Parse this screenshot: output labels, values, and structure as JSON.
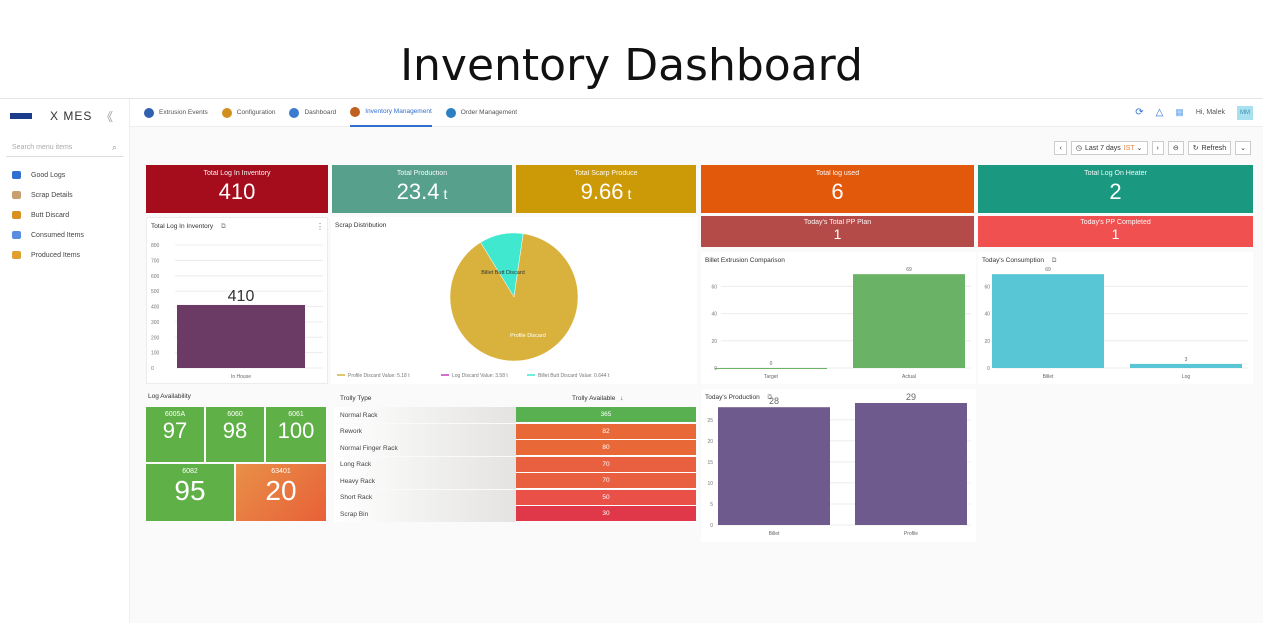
{
  "page_title": "Inventory Dashboard",
  "sidebar": {
    "brand": "X MES",
    "collapse": "《",
    "search_placeholder": "Search menu items",
    "items": [
      {
        "label": "Good Logs",
        "color": "#2f6fd0"
      },
      {
        "label": "Scrap Details",
        "color": "#c8a070"
      },
      {
        "label": "Butt Discard",
        "color": "#d89020"
      },
      {
        "label": "Consumed Items",
        "color": "#5a8fe0"
      },
      {
        "label": "Produced Items",
        "color": "#e0a030"
      }
    ]
  },
  "topnav": {
    "tabs": [
      {
        "label": "Extrusion Events",
        "color": "#3060b0"
      },
      {
        "label": "Configuration",
        "color": "#d09020"
      },
      {
        "label": "Dashboard",
        "color": "#3a7ad0"
      },
      {
        "label": "Inventory Management",
        "color": "#c06020"
      },
      {
        "label": "Order Management",
        "color": "#2a80c0"
      }
    ],
    "user_greeting": "Hi, Malek",
    "avatar_initials": "MM"
  },
  "timebar": {
    "prev": "‹",
    "range": "Last 7 days",
    "tz": "IST",
    "next": "›",
    "refresh": "Refresh"
  },
  "kpis": [
    {
      "label": "Total Log In Inventory",
      "value": "410",
      "unit": "",
      "color": "#a50d1c"
    },
    {
      "label": "Total Production",
      "value": "23.4",
      "unit": "t",
      "color": "#56a08c"
    },
    {
      "label": "Total Scarp Produce",
      "value": "9.66",
      "unit": "t",
      "color": "#cc9a06"
    },
    {
      "label": "Total log used",
      "value": "6",
      "unit": "",
      "color": "#e3590b"
    },
    {
      "label": "Total Log On Heater",
      "value": "2",
      "unit": "",
      "color": "#1a9880"
    }
  ],
  "pp_cards": [
    {
      "label": "Today's Total PP Plan",
      "value": "1",
      "color": "#b44b48"
    },
    {
      "label": "Today's PP Completed",
      "value": "1",
      "color": "#f05050"
    }
  ],
  "inventory_chart": {
    "title": "Total Log In Inventory",
    "ticks": [
      "800",
      "700",
      "600",
      "500",
      "400",
      "300",
      "200",
      "100",
      "0"
    ],
    "category": "In House",
    "value": 410,
    "value_label": "410",
    "color": "#6b3b66"
  },
  "scrap_chart": {
    "title": "Scrap Distribution",
    "slices": [
      {
        "name": "Profile Discard",
        "value": 5.18,
        "label": "Profile Discard  Value: 5.18 t",
        "color": "#d8b23c"
      },
      {
        "name": "Log Discard",
        "value": 3.58,
        "label": "Log Discard  Value: 3.58 t",
        "color": "#c040c0"
      },
      {
        "name": "Billet Butt Discard",
        "value": 0.644,
        "label": "Billet Butt Discard  Value: 0.644 t",
        "color": "#40e8d0"
      }
    ],
    "in_label_profile": "Profile Discard",
    "in_label_billet": "Billet Butt Discard"
  },
  "billet_chart": {
    "title": "Billet Extrusion Comparison",
    "ticks": [
      "60",
      "40",
      "20",
      "0"
    ],
    "bars": [
      {
        "category": "Target",
        "value": 0,
        "label": "0"
      },
      {
        "category": "Actual",
        "value": 69,
        "label": "69"
      }
    ],
    "color": "#6ab265"
  },
  "consumption_chart": {
    "title": "Today's Consumption",
    "ticks": [
      "60",
      "40",
      "20",
      "0"
    ],
    "bars": [
      {
        "category": "Billet",
        "value": 69,
        "label": "69"
      },
      {
        "category": "Log",
        "value": 3,
        "label": "3"
      }
    ],
    "color": "#58c6d4"
  },
  "log_availability": {
    "title": "Log Availability",
    "tiles": [
      {
        "label": "6005A",
        "value": "97"
      },
      {
        "label": "6060",
        "value": "98"
      },
      {
        "label": "6061",
        "value": "100"
      },
      {
        "label": "6082",
        "value": "95"
      },
      {
        "label": "63401",
        "value": "20"
      }
    ]
  },
  "trolly_table": {
    "col1": "Trolly Type",
    "col2": "Trolly Available",
    "sort_icon": "↓",
    "rows": [
      {
        "type": "Normal Rack",
        "value": "365",
        "color": "#58b050"
      },
      {
        "type": "Rework",
        "value": "82",
        "color": "#e86838"
      },
      {
        "type": "Normal Finger Rack",
        "value": "80",
        "color": "#e86838"
      },
      {
        "type": "Long Rack",
        "value": "70",
        "color": "#e86040"
      },
      {
        "type": "Heavy Rack",
        "value": "70",
        "color": "#e86040"
      },
      {
        "type": "Short Rack",
        "value": "50",
        "color": "#e85048"
      },
      {
        "type": "Scrap Bin",
        "value": "30",
        "color": "#e03848"
      }
    ]
  },
  "production_chart": {
    "title": "Today's Production",
    "ticks": [
      "25",
      "20",
      "15",
      "10",
      "5",
      "0"
    ],
    "bars": [
      {
        "category": "Billet",
        "value": 28,
        "label": "28"
      },
      {
        "category": "Profile",
        "value": 29,
        "label": "29"
      }
    ],
    "color": "#6e5a8c"
  }
}
